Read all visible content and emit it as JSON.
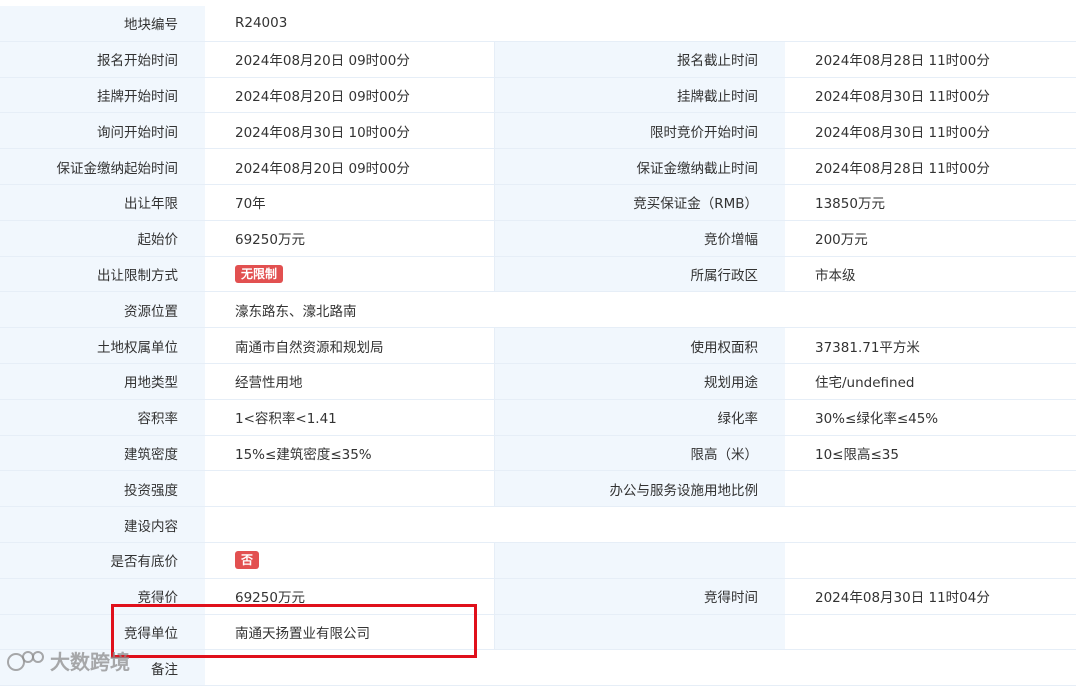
{
  "rows": [
    {
      "label": "地块编号",
      "value": "R24003"
    },
    {
      "l1": "报名开始时间",
      "v1": "2024年08月20日 09时00分",
      "l2": "报名截止时间",
      "v2": "2024年08月28日 11时00分"
    },
    {
      "l1": "挂牌开始时间",
      "v1": "2024年08月20日 09时00分",
      "l2": "挂牌截止时间",
      "v2": "2024年08月30日 11时00分"
    },
    {
      "l1": "询问开始时间",
      "v1": "2024年08月30日 10时00分",
      "l2": "限时竞价开始时间",
      "v2": "2024年08月30日 11时00分"
    },
    {
      "l1": "保证金缴纳起始时间",
      "v1": "2024年08月20日 09时00分",
      "l2": "保证金缴纳截止时间",
      "v2": "2024年08月28日 11时00分"
    },
    {
      "l1": "出让年限",
      "v1": "70年",
      "l2": "竞买保证金（RMB）",
      "v2": "13850万元"
    },
    {
      "l1": "起始价",
      "v1": "69250万元",
      "l2": "竞价增幅",
      "v2": "200万元"
    },
    {
      "l1": "出让限制方式",
      "badge1": "无限制",
      "l2": "所属行政区",
      "v2": "市本级"
    },
    {
      "label": "资源位置",
      "value": "濠东路东、濠北路南"
    },
    {
      "l1": "土地权属单位",
      "v1": "南通市自然资源和规划局",
      "l2": "使用权面积",
      "v2": "37381.71平方米"
    },
    {
      "l1": "用地类型",
      "v1": "经营性用地",
      "l2": "规划用途",
      "v2": "住宅/undefined"
    },
    {
      "l1": "容积率",
      "v1": "1<容积率<1.41",
      "l2": "绿化率",
      "v2": "30%≤绿化率≤45%"
    },
    {
      "l1": "建筑密度",
      "v1": "15%≤建筑密度≤35%",
      "l2": "限高（米）",
      "v2": "10≤限高≤35"
    },
    {
      "l1": "投资强度",
      "v1": "",
      "l2": "办公与服务设施用地比例",
      "v2": ""
    },
    {
      "label": "建设内容",
      "value": ""
    },
    {
      "l1": "是否有底价",
      "badge1": "否",
      "l2": "",
      "v2": ""
    },
    {
      "l1": "竞得价",
      "v1": "69250万元",
      "l2": "竞得时间",
      "v2": "2024年08月30日 11时04分"
    },
    {
      "l1": "竞得单位",
      "v1": "南通天扬置业有限公司",
      "l2": "",
      "v2": ""
    },
    {
      "label": "备注",
      "value": ""
    }
  ],
  "watermark": {
    "text": "大数跨境"
  },
  "colors": {
    "label_bg": "#f1f7fd",
    "border": "#e6eef7",
    "badge": "#e25050",
    "highlight": "#e0101b"
  }
}
